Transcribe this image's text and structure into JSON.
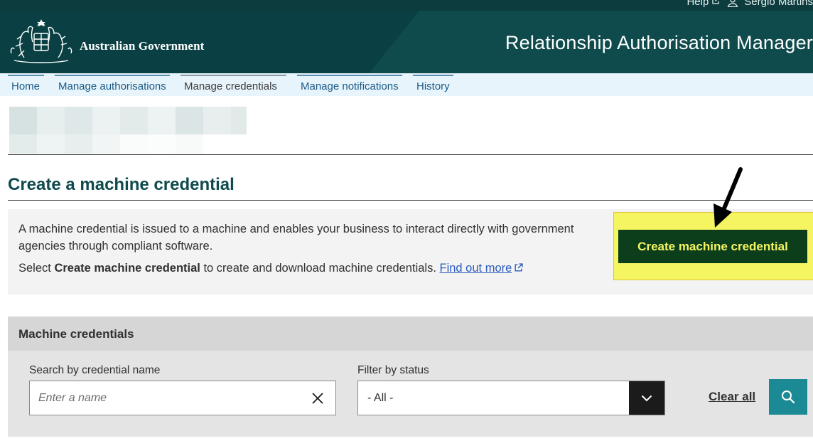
{
  "utility": {
    "help_label": "Help",
    "user_name": "Sergio Martins"
  },
  "header": {
    "gov_name": "Australian Government",
    "app_title": "Relationship Authorisation Manager"
  },
  "nav": {
    "tabs": [
      {
        "label": "Home"
      },
      {
        "label": "Manage authorisations"
      },
      {
        "label": "Manage credentials"
      },
      {
        "label": "Manage notifications"
      },
      {
        "label": "History"
      }
    ],
    "active": "Manage credentials"
  },
  "page": {
    "title": "Create a machine credential"
  },
  "info": {
    "text_1": "A machine credential is issued to a machine and enables your business to interact directly with government agencies through compliant software.",
    "text_2_prefix": "Select ",
    "text_2_bold": "Create machine credential",
    "text_2_suffix": " to create and download machine credentials. ",
    "link_label": "Find out more",
    "create_button_label": "Create machine credential"
  },
  "credentials": {
    "title": "Machine credentials",
    "search_label": "Search by credential name",
    "search_placeholder": "Enter a name",
    "search_value": "",
    "filter_label": "Filter by status",
    "filter_value": "- All -",
    "clear_all_label": "Clear all"
  },
  "colors": {
    "header_bg": "#0f4a4d",
    "nav_bg": "#e8f4fb",
    "button_bg": "#0d3e1c",
    "button_text": "#f5f562",
    "highlight": "#f5f562",
    "search_button_bg": "#1b8a94"
  },
  "icons": {
    "external_link": "external-link-icon",
    "user": "user-icon",
    "close": "close-icon",
    "chevron": "chevron-down-icon",
    "search": "search-icon",
    "annotation_arrow": "arrow-icon"
  }
}
